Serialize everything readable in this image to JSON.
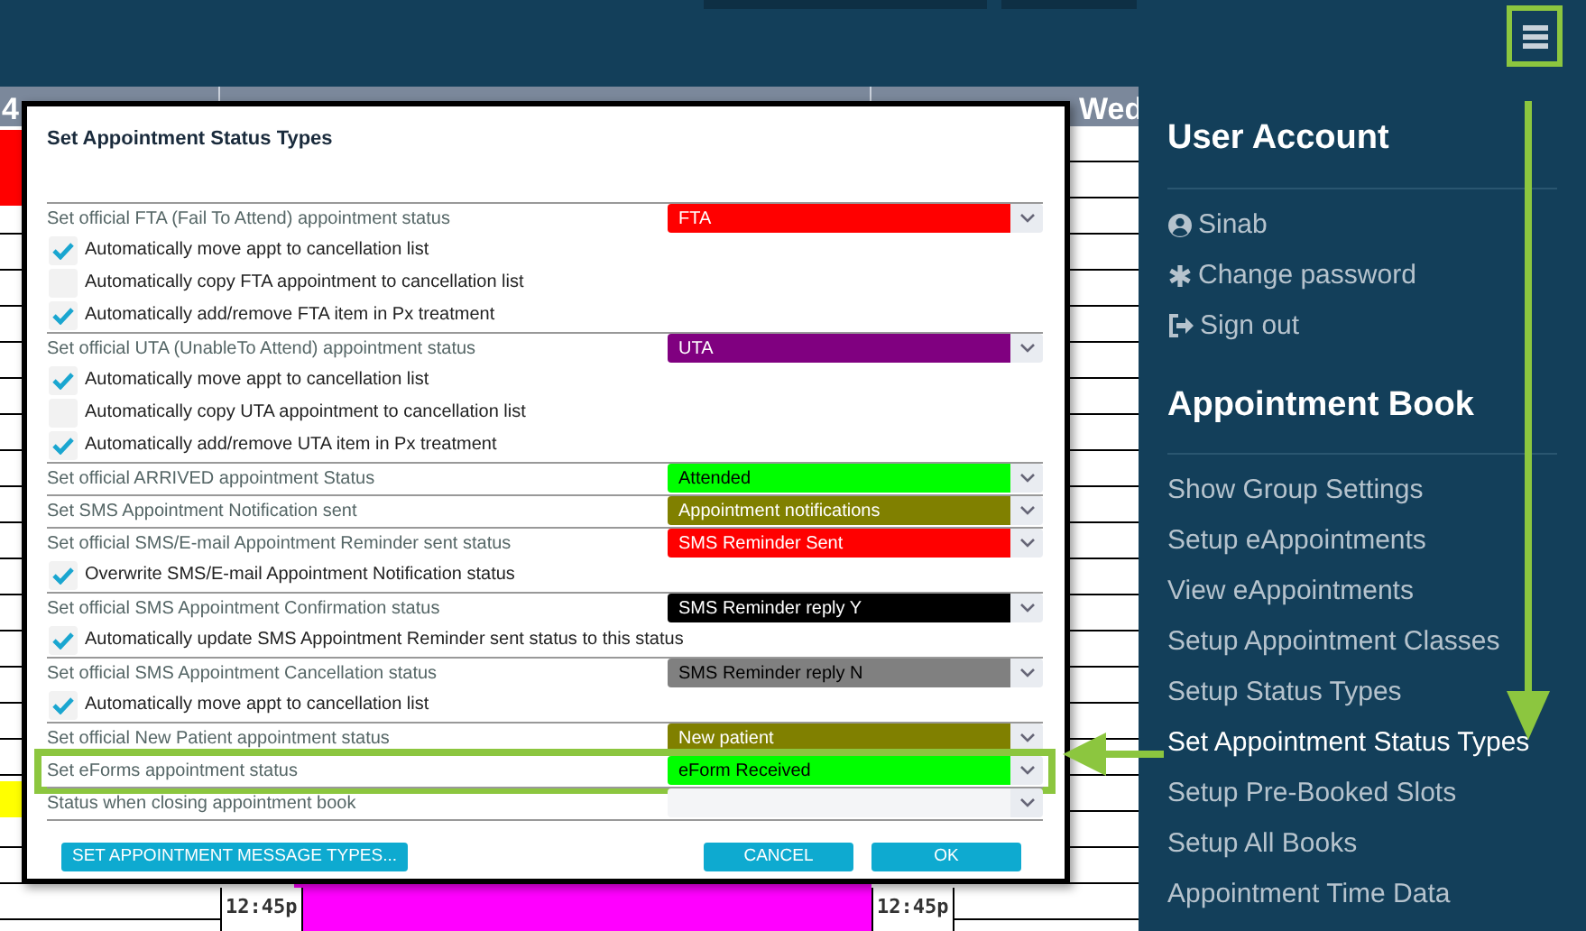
{
  "calendar": {
    "headers": [
      "4",
      "Wed"
    ],
    "time_labels": [
      "12:45p",
      "12:45p"
    ],
    "events": [
      {
        "color": "#ff0000"
      },
      {
        "color": "#ffff00"
      },
      {
        "color": "#ff00ff"
      }
    ]
  },
  "menu_button": {
    "highlighted": true
  },
  "dialog": {
    "title": "Set Appointment Status Types",
    "rows": [
      {
        "kind": "select",
        "label": "Set official FTA (Fail To Attend) appointment status",
        "value": "FTA",
        "color": "#ff0000",
        "highlighted": false
      },
      {
        "kind": "checkbox",
        "label": "Automatically move appt to cancellation list",
        "checked": true
      },
      {
        "kind": "checkbox",
        "label": "Automatically copy FTA appointment to cancellation list",
        "checked": false
      },
      {
        "kind": "checkbox",
        "label": "Automatically add/remove FTA item in Px treatment",
        "checked": true
      },
      {
        "kind": "select",
        "label": "Set official UTA (UnableTo Attend) appointment status",
        "value": "UTA",
        "color": "#800080",
        "highlighted": false
      },
      {
        "kind": "checkbox",
        "label": "Automatically move appt to cancellation list",
        "checked": true
      },
      {
        "kind": "checkbox",
        "label": "Automatically copy UTA appointment to cancellation list",
        "checked": false
      },
      {
        "kind": "checkbox",
        "label": "Automatically add/remove UTA item in Px treatment",
        "checked": true
      },
      {
        "kind": "select",
        "label": "Set official ARRIVED appointment Status",
        "value": "Attended",
        "color": "#00ff00",
        "highlighted": false
      },
      {
        "kind": "select",
        "label": "Set SMS Appointment Notification sent",
        "value": "Appointment notifications",
        "color": "#808000",
        "highlighted": false
      },
      {
        "kind": "select",
        "label": "Set official SMS/E-mail Appointment Reminder sent status",
        "value": "SMS Reminder Sent",
        "color": "#ff0000",
        "highlighted": false
      },
      {
        "kind": "checkbox",
        "label": "Overwrite SMS/E-mail Appointment Notification status",
        "checked": true
      },
      {
        "kind": "select",
        "label": "Set official SMS Appointment Confirmation status",
        "value": "SMS Reminder reply Y",
        "color": "#000000",
        "highlighted": false
      },
      {
        "kind": "checkbox",
        "label": "Automatically update SMS Appointment Reminder sent status to this status",
        "checked": true
      },
      {
        "kind": "select",
        "label": "Set official SMS Appointment Cancellation status",
        "value": "SMS Reminder reply N",
        "color": "#808080",
        "highlighted": false
      },
      {
        "kind": "checkbox",
        "label": "Automatically move appt to cancellation list",
        "checked": true
      },
      {
        "kind": "select",
        "label": "Set official New Patient appointment status",
        "value": "New patient",
        "color": "#808000",
        "highlighted": false
      },
      {
        "kind": "select",
        "label": "Set eForms appointment status",
        "value": "eForm Received",
        "color": "#00ff00",
        "highlighted": true
      },
      {
        "kind": "select",
        "label": "Status when closing appointment book",
        "highlighted": false
      }
    ],
    "buttons": [
      {
        "label": "SET APPOINTMENT MESSAGE TYPES..."
      },
      {
        "label": "CANCEL"
      },
      {
        "label": "OK"
      }
    ]
  },
  "sidebar": {
    "sections": [
      {
        "title": "User Account",
        "items": [
          {
            "label": "Sinab",
            "kind": "user",
            "selected": false
          },
          {
            "label": "Change password",
            "kind": "asterisk",
            "selected": false
          },
          {
            "label": "Sign out",
            "kind": "signout",
            "selected": false
          }
        ]
      },
      {
        "title": "Appointment Book",
        "items": [
          {
            "label": "Show Group Settings",
            "selected": false
          },
          {
            "label": "Setup eAppointments",
            "selected": false
          },
          {
            "label": "View eAppointments",
            "selected": false
          },
          {
            "label": "Setup Appointment Classes",
            "selected": false
          },
          {
            "label": "Setup Status Types",
            "selected": false
          },
          {
            "label": "Set Appointment Status Types",
            "selected": true
          },
          {
            "label": "Setup Pre-Booked Slots",
            "selected": false
          },
          {
            "label": "Setup All Books",
            "selected": false
          },
          {
            "label": "Appointment Time Data",
            "selected": false
          }
        ]
      }
    ]
  }
}
